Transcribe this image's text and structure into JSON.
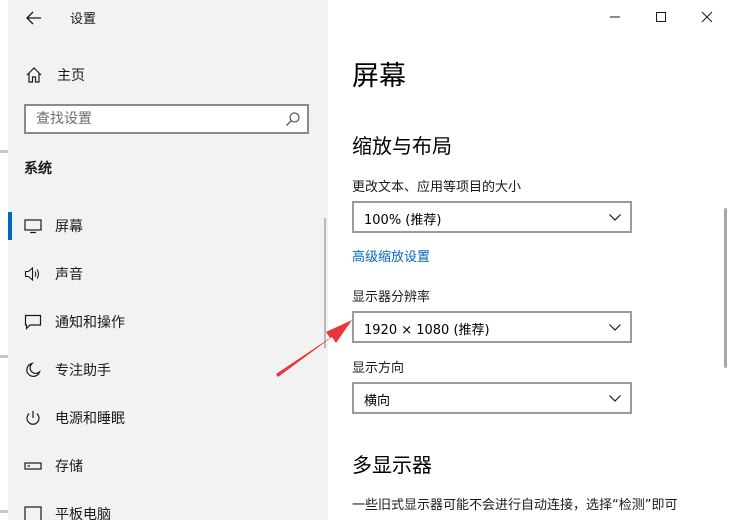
{
  "window": {
    "app_title": "设置",
    "controls": {
      "minimize": "minimize",
      "maximize": "maximize",
      "close": "close"
    }
  },
  "sidebar": {
    "home_label": "主页",
    "search_placeholder": "查找设置",
    "section_heading": "系统",
    "items": [
      {
        "label": "屏幕",
        "icon": "monitor-icon",
        "selected": true
      },
      {
        "label": "声音",
        "icon": "speaker-icon",
        "selected": false
      },
      {
        "label": "通知和操作",
        "icon": "notification-icon",
        "selected": false
      },
      {
        "label": "专注助手",
        "icon": "moon-icon",
        "selected": false
      },
      {
        "label": "电源和睡眠",
        "icon": "power-icon",
        "selected": false
      },
      {
        "label": "存储",
        "icon": "storage-icon",
        "selected": false
      },
      {
        "label": "平板电脑",
        "icon": "tablet-icon",
        "selected": false
      }
    ]
  },
  "content": {
    "page_title": "屏幕",
    "scale_layout": {
      "title": "缩放与布局",
      "text_size_label": "更改文本、应用等项目的大小",
      "text_size_value": "100% (推荐)",
      "advanced_link": "高级缩放设置",
      "resolution_label": "显示器分辨率",
      "resolution_value": "1920 × 1080 (推荐)",
      "orientation_label": "显示方向",
      "orientation_value": "横向"
    },
    "multi_display": {
      "title": "多显示器",
      "description": "一些旧式显示器可能不会进行自动连接，选择“检测”即可"
    }
  },
  "colors": {
    "accent": "#0067c0",
    "sidebar_bg": "#f2f2f2",
    "annotation_arrow": "#e8373a"
  }
}
